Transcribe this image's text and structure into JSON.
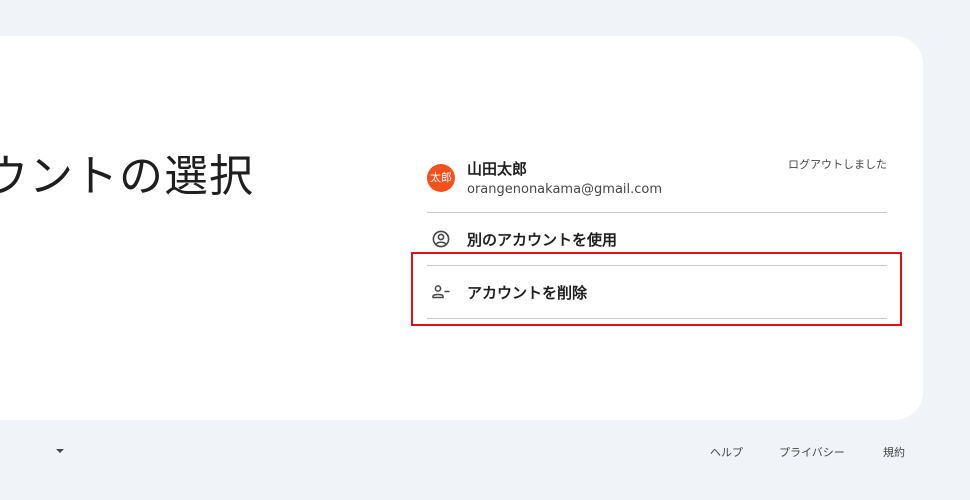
{
  "page": {
    "heading": "ウントの選択"
  },
  "account": {
    "avatar_text": "太郎",
    "avatar_color": "#f4511e",
    "name": "山田太郎",
    "email": "orangenonakama@gmail.com",
    "status": "ログアウトしました"
  },
  "menu": {
    "use_another": {
      "label": "別のアカウントを使用",
      "icon": "account-circle-icon"
    },
    "remove_account": {
      "label": "アカウントを削除",
      "icon": "person-remove-icon"
    }
  },
  "highlight": {
    "color": "#d9151b"
  },
  "footer": {
    "language_icon": "dropdown-caret-icon",
    "help": "ヘルプ",
    "privacy": "プライバシー",
    "terms": "規約"
  }
}
